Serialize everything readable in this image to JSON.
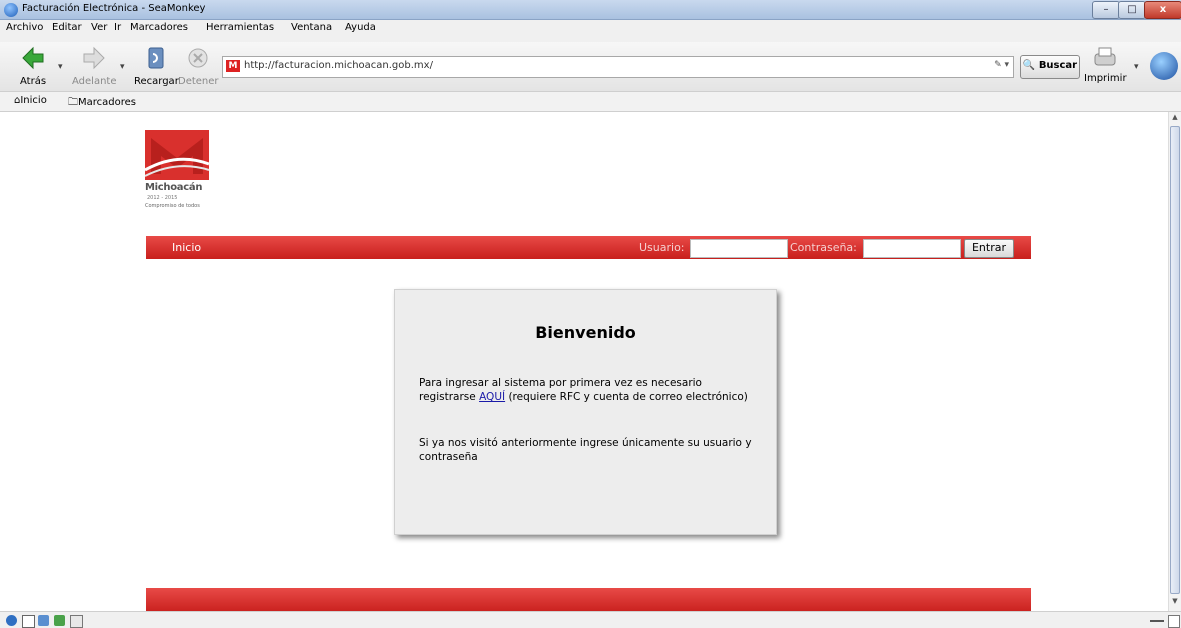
{
  "window": {
    "title": "Facturación Electrónica - SeaMonkey",
    "min": "–",
    "max": "□",
    "close": "x"
  },
  "menu": [
    "Archivo",
    "Editar",
    "Ver",
    "Ir",
    "Marcadores",
    "Herramientas",
    "Ventana",
    "Ayuda"
  ],
  "toolbar": {
    "back": "Atrás",
    "forward": "Adelante",
    "reload": "Recargar",
    "stop": "Detener",
    "url": "http://facturacion.michoacan.gob.mx/",
    "search": "Buscar",
    "print": "Imprimir"
  },
  "bookmarks": {
    "home": "Inicio",
    "bookmarks": "Marcadores"
  },
  "logo": {
    "name": "Michoacán",
    "years": "2012 - 2015",
    "slogan": "Compromiso de todos"
  },
  "nav": {
    "home": "Inicio",
    "user_label": "Usuario:",
    "user_value": "",
    "password_label": "Contraseña:",
    "password_value": "",
    "submit": "Entrar"
  },
  "welcome": {
    "title": "Bienvenido",
    "p1_before": "Para ingresar al sistema por primera vez es necesario registrarse ",
    "p1_link": "AQUÍ",
    "p1_after": " (requiere RFC y cuenta de correo electrónico)",
    "p2": "Si ya nos visitó anteriormente ingrese únicamente su usuario y contraseña"
  },
  "colors": {
    "brand_red": "#d9302d",
    "panel": "#ededed",
    "link": "#1a1aa8"
  }
}
